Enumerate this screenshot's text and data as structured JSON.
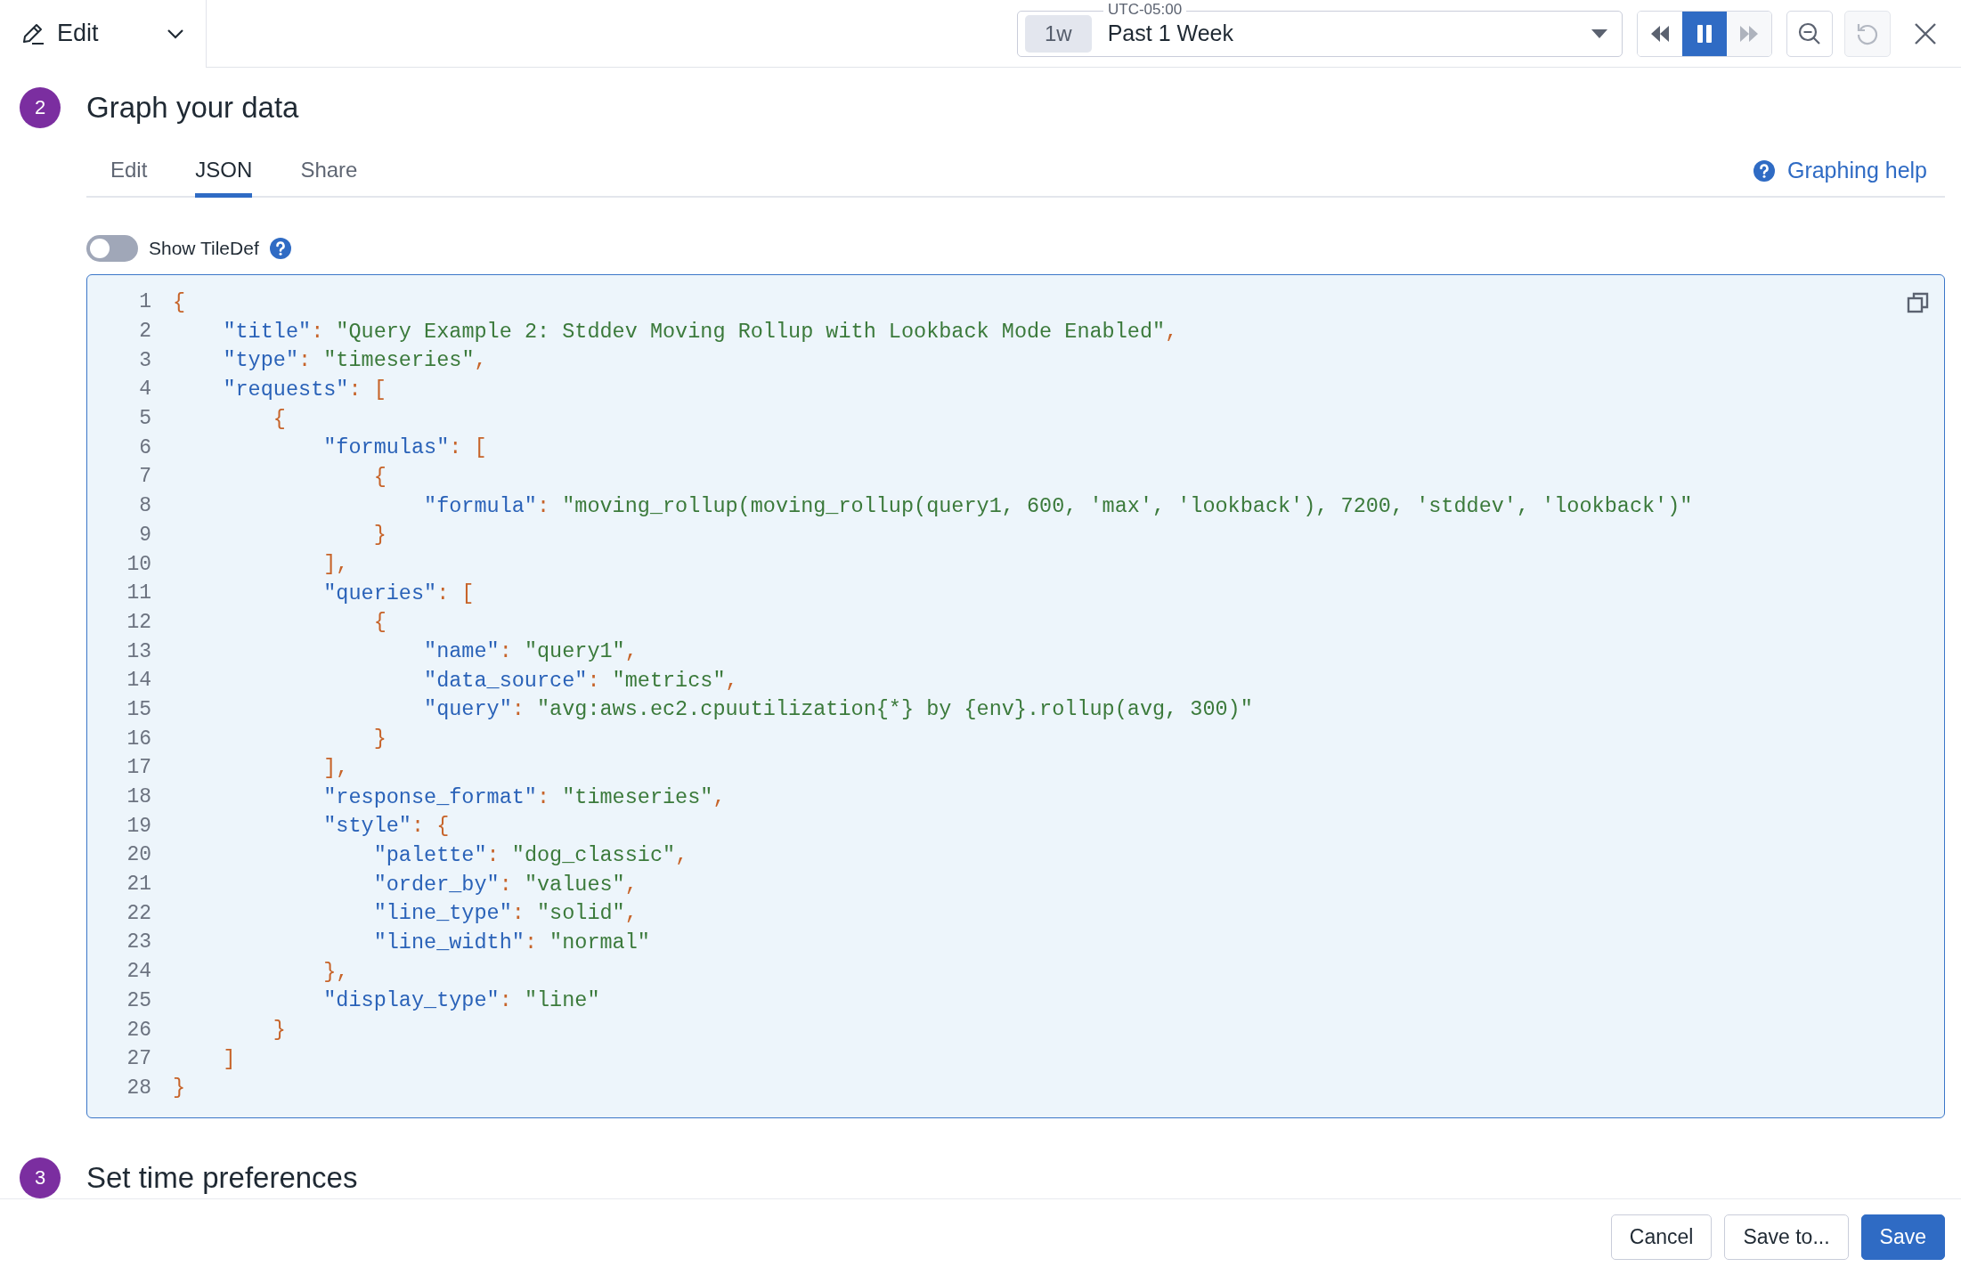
{
  "top_bar": {
    "mode_menu": {
      "label": "Edit"
    },
    "time_picker": {
      "timezone": "UTC-05:00",
      "badge": "1w",
      "value": "Past 1 Week"
    },
    "controls": [
      {
        "kind": "rewind",
        "selected": false,
        "disabled": false
      },
      {
        "kind": "pause",
        "selected": true,
        "disabled": false
      },
      {
        "kind": "forward",
        "selected": false,
        "disabled": true
      }
    ],
    "zoom_out": {
      "disabled": false
    },
    "reset": {
      "disabled": true
    }
  },
  "sections": [
    {
      "number": "2",
      "title": "Graph your data"
    },
    {
      "number": "3",
      "title": "Set time preferences"
    }
  ],
  "tabs": [
    {
      "label": "Edit",
      "selected": false
    },
    {
      "label": "JSON",
      "selected": true
    },
    {
      "label": "Share",
      "selected": false
    }
  ],
  "help_link": "Graphing help",
  "tiledef_toggle": {
    "label": "Show TileDef",
    "on": false
  },
  "editor": {
    "lines": [
      {
        "number": "1",
        "tokens": [
          {
            "kind": "punct",
            "text": "{"
          }
        ]
      },
      {
        "number": "2",
        "tokens": [
          {
            "kind": "key",
            "text": "    \"title\""
          },
          {
            "kind": "punct",
            "text": ": "
          },
          {
            "kind": "str",
            "text": "\"Query Example 2: Stddev Moving Rollup with Lookback Mode Enabled\""
          },
          {
            "kind": "punct",
            "text": ","
          }
        ]
      },
      {
        "number": "3",
        "tokens": [
          {
            "kind": "key",
            "text": "    \"type\""
          },
          {
            "kind": "punct",
            "text": ": "
          },
          {
            "kind": "str",
            "text": "\"timeseries\""
          },
          {
            "kind": "punct",
            "text": ","
          }
        ]
      },
      {
        "number": "4",
        "tokens": [
          {
            "kind": "key",
            "text": "    \"requests\""
          },
          {
            "kind": "punct",
            "text": ": ["
          }
        ]
      },
      {
        "number": "5",
        "tokens": [
          {
            "kind": "punct",
            "text": "        {"
          }
        ]
      },
      {
        "number": "6",
        "tokens": [
          {
            "kind": "key",
            "text": "            \"formulas\""
          },
          {
            "kind": "punct",
            "text": ": ["
          }
        ]
      },
      {
        "number": "7",
        "tokens": [
          {
            "kind": "punct",
            "text": "                {"
          }
        ]
      },
      {
        "number": "8",
        "tokens": [
          {
            "kind": "key",
            "text": "                    \"formula\""
          },
          {
            "kind": "punct",
            "text": ": "
          },
          {
            "kind": "str",
            "text": "\"moving_rollup(moving_rollup(query1, 600, 'max', 'lookback'), 7200, 'stddev', 'lookback')\""
          }
        ]
      },
      {
        "number": "9",
        "tokens": [
          {
            "kind": "punct",
            "text": "                }"
          }
        ]
      },
      {
        "number": "10",
        "tokens": [
          {
            "kind": "punct",
            "text": "            ],"
          }
        ]
      },
      {
        "number": "11",
        "tokens": [
          {
            "kind": "key",
            "text": "            \"queries\""
          },
          {
            "kind": "punct",
            "text": ": ["
          }
        ]
      },
      {
        "number": "12",
        "tokens": [
          {
            "kind": "punct",
            "text": "                {"
          }
        ]
      },
      {
        "number": "13",
        "tokens": [
          {
            "kind": "key",
            "text": "                    \"name\""
          },
          {
            "kind": "punct",
            "text": ": "
          },
          {
            "kind": "str",
            "text": "\"query1\""
          },
          {
            "kind": "punct",
            "text": ","
          }
        ]
      },
      {
        "number": "14",
        "tokens": [
          {
            "kind": "key",
            "text": "                    \"data_source\""
          },
          {
            "kind": "punct",
            "text": ": "
          },
          {
            "kind": "str",
            "text": "\"metrics\""
          },
          {
            "kind": "punct",
            "text": ","
          }
        ]
      },
      {
        "number": "15",
        "tokens": [
          {
            "kind": "key",
            "text": "                    \"query\""
          },
          {
            "kind": "punct",
            "text": ": "
          },
          {
            "kind": "str",
            "text": "\"avg:aws.ec2.cpuutilization{*} by {env}.rollup(avg, 300)\""
          }
        ]
      },
      {
        "number": "16",
        "tokens": [
          {
            "kind": "punct",
            "text": "                }"
          }
        ]
      },
      {
        "number": "17",
        "tokens": [
          {
            "kind": "punct",
            "text": "            ],"
          }
        ]
      },
      {
        "number": "18",
        "tokens": [
          {
            "kind": "key",
            "text": "            \"response_format\""
          },
          {
            "kind": "punct",
            "text": ": "
          },
          {
            "kind": "str",
            "text": "\"timeseries\""
          },
          {
            "kind": "punct",
            "text": ","
          }
        ]
      },
      {
        "number": "19",
        "tokens": [
          {
            "kind": "key",
            "text": "            \"style\""
          },
          {
            "kind": "punct",
            "text": ": {"
          }
        ]
      },
      {
        "number": "20",
        "tokens": [
          {
            "kind": "key",
            "text": "                \"palette\""
          },
          {
            "kind": "punct",
            "text": ": "
          },
          {
            "kind": "str",
            "text": "\"dog_classic\""
          },
          {
            "kind": "punct",
            "text": ","
          }
        ]
      },
      {
        "number": "21",
        "tokens": [
          {
            "kind": "key",
            "text": "                \"order_by\""
          },
          {
            "kind": "punct",
            "text": ": "
          },
          {
            "kind": "str",
            "text": "\"values\""
          },
          {
            "kind": "punct",
            "text": ","
          }
        ]
      },
      {
        "number": "22",
        "tokens": [
          {
            "kind": "key",
            "text": "                \"line_type\""
          },
          {
            "kind": "punct",
            "text": ": "
          },
          {
            "kind": "str",
            "text": "\"solid\""
          },
          {
            "kind": "punct",
            "text": ","
          }
        ]
      },
      {
        "number": "23",
        "tokens": [
          {
            "kind": "key",
            "text": "                \"line_width\""
          },
          {
            "kind": "punct",
            "text": ": "
          },
          {
            "kind": "str",
            "text": "\"normal\""
          }
        ]
      },
      {
        "number": "24",
        "tokens": [
          {
            "kind": "punct",
            "text": "            },"
          }
        ]
      },
      {
        "number": "25",
        "tokens": [
          {
            "kind": "key",
            "text": "            \"display_type\""
          },
          {
            "kind": "punct",
            "text": ": "
          },
          {
            "kind": "str",
            "text": "\"line\""
          }
        ]
      },
      {
        "number": "26",
        "tokens": [
          {
            "kind": "punct",
            "text": "        }"
          }
        ]
      },
      {
        "number": "27",
        "tokens": [
          {
            "kind": "punct",
            "text": "    ]"
          }
        ]
      },
      {
        "number": "28",
        "tokens": [
          {
            "kind": "punct",
            "text": "}"
          }
        ]
      }
    ]
  },
  "footer_buttons": [
    {
      "label": "Cancel",
      "kind": "secondary"
    },
    {
      "label": "Save to...",
      "kind": "secondary"
    },
    {
      "label": "Save",
      "kind": "primary"
    }
  ]
}
